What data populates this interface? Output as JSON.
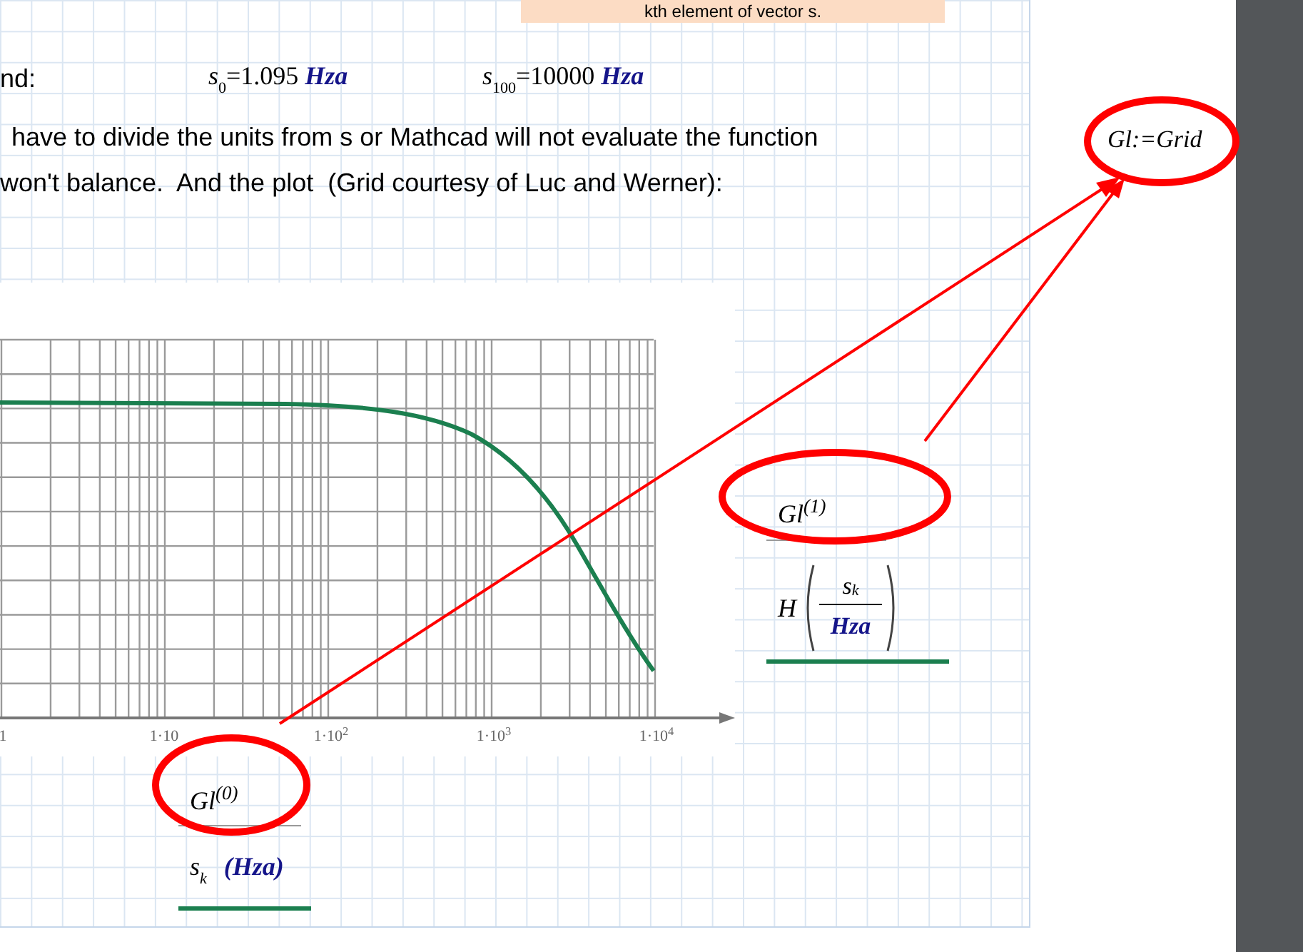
{
  "note": {
    "text": "kth element of vector s."
  },
  "range_line": {
    "label": "nd:",
    "values": [
      {
        "symbol": "s",
        "subscript": "0",
        "equals": "=",
        "value": "1.095",
        "unit": "Hza"
      },
      {
        "symbol": "s",
        "subscript": "100",
        "equals": "=",
        "value": "10000",
        "unit": "Hza"
      }
    ]
  },
  "paragraph": [
    "have to divide the units from s or Mathcad will not evaluate the function",
    "won't balance.  And the plot  (Grid courtesy of Luc and Werner):"
  ],
  "plot": {
    "x_tick_labels": [
      "1",
      "1·10",
      "1·10$^{2}$",
      "1·10$^{3}$",
      "1·10$^{4}$"
    ],
    "grid_label_x": "Gl$^{(0)}$",
    "x_expression": {
      "symbol": "s",
      "subscript": "k",
      "unit": "(Hza)"
    },
    "grid_label_y": "Gl$^{(1)}$",
    "y_expression": {
      "function": "H",
      "numerator": "s",
      "subscript": "k",
      "denominator": "Hza"
    }
  },
  "definition": {
    "text": "Gl:=Grid"
  }
}
